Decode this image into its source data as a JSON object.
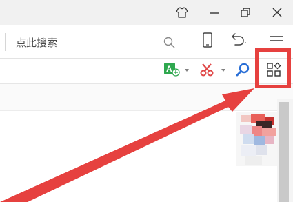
{
  "titlebar": {
    "skin_icon": "tshirt-skin-icon",
    "minimize_icon": "minimize-icon",
    "restore_icon": "restore-window-icon",
    "close_icon": "close-icon"
  },
  "search": {
    "placeholder": "点此搜索",
    "icon": "search-icon"
  },
  "addressbar": {
    "mobile_icon": "mobile-phone-icon",
    "undo_icon": "undo-icon",
    "menu_icon": "hamburger-menu-icon"
  },
  "toolbar": {
    "translate_icon": "translate-icon",
    "screenshot_icon": "scissors-icon",
    "find_icon": "magnifier-icon",
    "extensions_icon": "app-grid-icon"
  },
  "annotation": {
    "highlight_color": "#e6413f",
    "arrow_color": "#e6413f"
  },
  "colors": {
    "titlebar_bg": "#f1f1f1",
    "translate_green": "#2fa84f",
    "scissors_red": "#e04848",
    "magnifier_blue": "#2a6fd6",
    "scrollbar": "#c9c9c9"
  }
}
